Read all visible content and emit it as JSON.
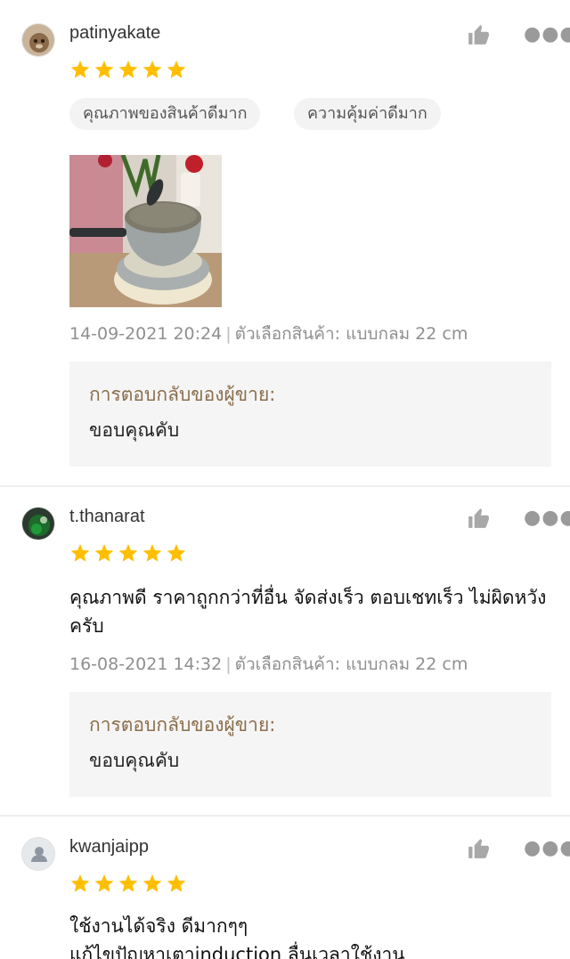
{
  "reviews": [
    {
      "username": "patinyakate",
      "rating": 5,
      "tags": [
        "คุณภาพของสินค้าดีมาก",
        "ความคุ้มค่าดีมาก"
      ],
      "comment": "",
      "date": "14-09-2021 20:24",
      "option_label": "ตัวเลือกสินค้า: แบบกลม 22 cm",
      "seller_reply_title": "การตอบกลับของผู้ขาย:",
      "seller_reply_text": "ขอบคุณคับ"
    },
    {
      "username": "t.thanarat",
      "rating": 5,
      "comment": "คุณภาพดี ราคาถูกกว่าที่อื่น จัดส่งเร็ว ตอบเชทเร็ว ไม่ผิดหวังครับ",
      "date": "16-08-2021 14:32",
      "option_label": "ตัวเลือกสินค้า: แบบกลม 22 cm",
      "seller_reply_title": "การตอบกลับของผู้ขาย:",
      "seller_reply_text": "ขอบคุณคับ"
    },
    {
      "username": "kwanjaipp",
      "rating": 5,
      "comment_line1": "ใช้งานได้จริง ดีมากๆๆ",
      "comment_line2": "แก้ไขปัญหาเตาinduction ลื่นเวลาใช้งาน"
    }
  ],
  "separator": "|",
  "colors": {
    "star": "#ffbf00",
    "reply_title": "#8a6d4b",
    "reply_bg": "#f5f5f5",
    "icon_gray": "#9a9a9a"
  },
  "icons": {
    "like": "thumbs-up-icon",
    "more": "more-dots-icon",
    "star": "star-icon",
    "default_avatar": "user-icon"
  }
}
